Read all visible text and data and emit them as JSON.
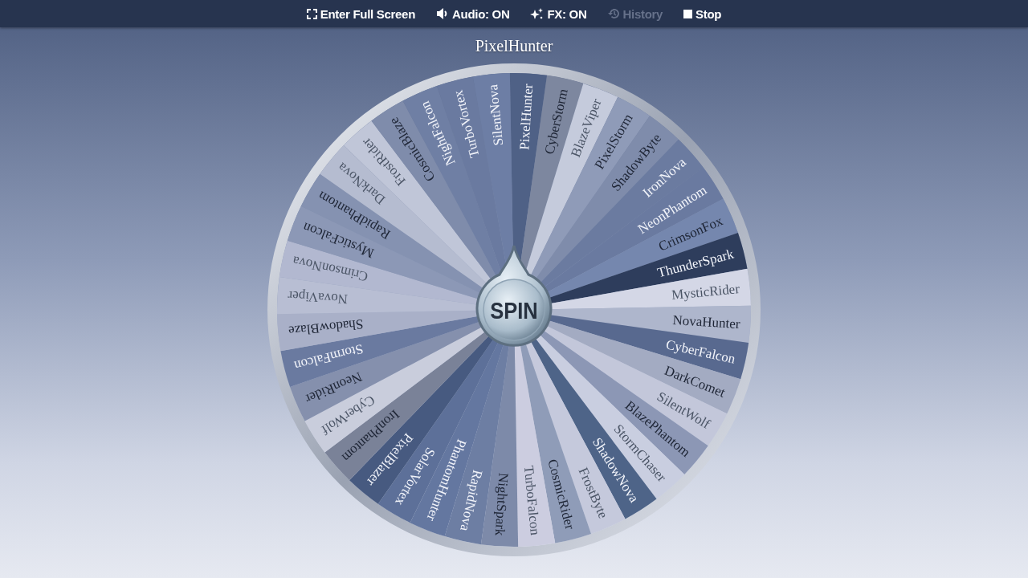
{
  "toolbar": {
    "items": [
      {
        "kind": "fullscreen",
        "label": "Enter Full Screen",
        "disabled": false
      },
      {
        "kind": "audio",
        "label": "Audio: ON",
        "disabled": false
      },
      {
        "kind": "fx",
        "label": "FX: ON",
        "disabled": false
      },
      {
        "kind": "history",
        "label": "History",
        "disabled": true
      },
      {
        "kind": "stop",
        "label": "Stop",
        "disabled": false
      }
    ]
  },
  "wheel": {
    "title": "PixelHunter",
    "spin_label": "SPIN",
    "segments": [
      {
        "name": "PixelHunter"
      },
      {
        "name": "CyberStorm"
      },
      {
        "name": "BlazeViper"
      },
      {
        "name": "PixelStorm"
      },
      {
        "name": "ShadowByte"
      },
      {
        "name": "IronNova"
      },
      {
        "name": "NeonPhantom"
      },
      {
        "name": "CrimsonFox"
      },
      {
        "name": "ThunderSpark"
      },
      {
        "name": "MysticRider"
      },
      {
        "name": "NovaHunter"
      },
      {
        "name": "CyberFalcon"
      },
      {
        "name": "DarkComet"
      },
      {
        "name": "SilentWolf"
      },
      {
        "name": "BlazePhantom"
      },
      {
        "name": "StormChaser"
      },
      {
        "name": "ShadowNova"
      },
      {
        "name": "FrostByte"
      },
      {
        "name": "CosmicRider"
      },
      {
        "name": "TurboFalcon"
      },
      {
        "name": "NightSpark"
      },
      {
        "name": "RapidNova"
      },
      {
        "name": "PhantomHunter"
      },
      {
        "name": "SolarVortex"
      },
      {
        "name": "PixelBlazer"
      },
      {
        "name": "IronPhantom"
      },
      {
        "name": "CyberWolf"
      },
      {
        "name": "NeonRider"
      },
      {
        "name": "StormFalcon"
      },
      {
        "name": "ShadowBlaze"
      },
      {
        "name": "NovaViper"
      },
      {
        "name": "CrimsonNova"
      },
      {
        "name": "MysticFalcon"
      },
      {
        "name": "RapidPhantom"
      },
      {
        "name": "DarkNova"
      },
      {
        "name": "FrostRider"
      },
      {
        "name": "CosmicBlaze"
      },
      {
        "name": "NightFalcon"
      },
      {
        "name": "TurboVortex"
      },
      {
        "name": "SilentNova"
      }
    ]
  }
}
